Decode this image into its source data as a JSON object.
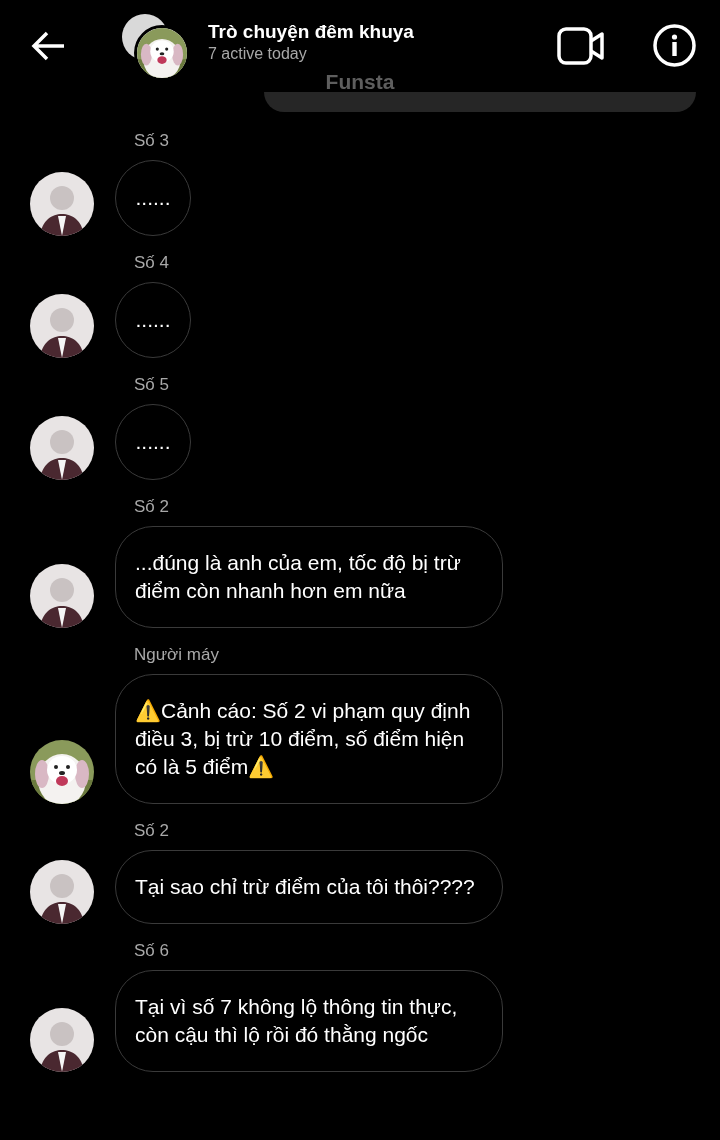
{
  "header": {
    "title": "Trò chuyện đêm khuya",
    "subtitle": "7 active today"
  },
  "previous_message": {
    "sender": "Funsta"
  },
  "messages": [
    {
      "sender": "Số 3",
      "avatar": {
        "kind": "person"
      },
      "text": "......",
      "kind": "short"
    },
    {
      "sender": "Số 4",
      "avatar": {
        "kind": "person"
      },
      "text": "......",
      "kind": "short"
    },
    {
      "sender": "Số 5",
      "avatar": {
        "kind": "person"
      },
      "text": "......",
      "kind": "short"
    },
    {
      "sender": "Số 2",
      "avatar": {
        "kind": "person"
      },
      "text": "...đúng là anh của em, tốc độ bị trừ điểm còn nhanh hơn em nữa",
      "kind": "long"
    },
    {
      "sender": "Người máy",
      "avatar": {
        "kind": "dog"
      },
      "text": "⚠️Cảnh cáo: Số 2 vi phạm quy định điều 3, bị trừ 10 điểm, số điểm hiện có là 5 điểm⚠️",
      "kind": "long"
    },
    {
      "sender": "Số 2",
      "avatar": {
        "kind": "person"
      },
      "text": "Tại sao chỉ trừ điểm của tôi thôi????",
      "kind": "long"
    },
    {
      "sender": "Số 6",
      "avatar": {
        "kind": "person"
      },
      "text": "Tại vì số 7 không lộ thông tin thực, còn cậu thì lộ rồi đó thằng ngốc",
      "kind": "long"
    }
  ]
}
